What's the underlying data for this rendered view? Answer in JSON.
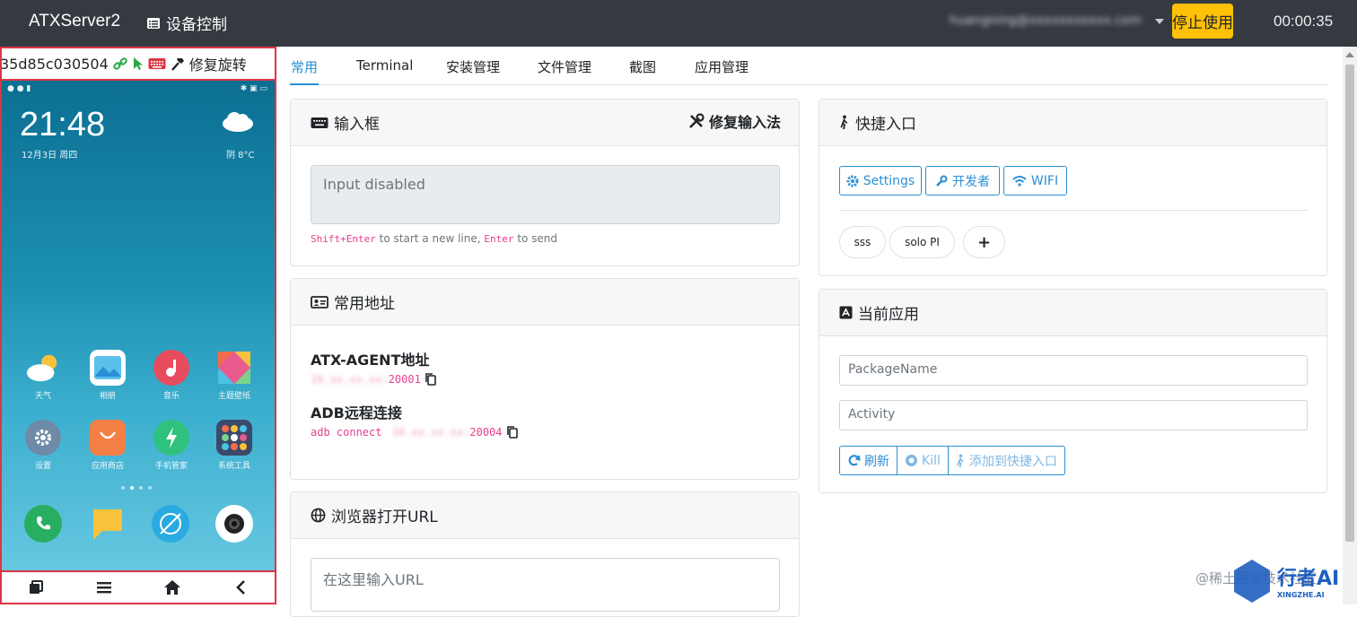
{
  "header": {
    "brand": "ATXServer2",
    "nav_device": "设备控制",
    "user_email": "huangning@xxxxxxxxxxx.com",
    "stop_label": "停止使用",
    "timer": "00:00:35"
  },
  "device": {
    "serial": "35d85c030504",
    "fix_rotate": "修复旋转",
    "screen": {
      "time": "21:48",
      "date": "12月3日 周四",
      "weather": "阴  8°C",
      "apps_row1": [
        "天气",
        "相册",
        "音乐",
        "主题壁纸"
      ],
      "apps_row2": [
        "设置",
        "应用商店",
        "手机管家",
        "系统工具"
      ]
    }
  },
  "tabs": [
    "常用",
    "Terminal",
    "安装管理",
    "文件管理",
    "截图",
    "应用管理"
  ],
  "input_card": {
    "title": "输入框",
    "fix_ime": "修复输入法",
    "placeholder": "Input disabled",
    "hint_key1": "Shift+Enter",
    "hint_text1": " to start a new line, ",
    "hint_key2": "Enter",
    "hint_text2": " to send"
  },
  "address_card": {
    "title": "常用地址",
    "atx_title": "ATX-AGENT地址",
    "atx_host": "10.xx.xx.xx:",
    "atx_port": "20001",
    "adb_title": "ADB远程连接",
    "adb_cmd": "adb connect ",
    "adb_host": "10.xx.xx.xx:",
    "adb_port": "20004"
  },
  "url_card": {
    "title": "浏览器打开URL",
    "placeholder": "在这里输入URL"
  },
  "shortcut_card": {
    "title": "快捷入口",
    "btn_settings": "Settings",
    "btn_dev": "开发者",
    "btn_wifi": "WIFI",
    "pills": [
      "sss",
      "solo PI",
      "+"
    ]
  },
  "current_app_card": {
    "title": "当前应用",
    "package_placeholder": "PackageName",
    "activity_placeholder": "Activity",
    "btn_refresh": "刷新",
    "btn_kill": "Kill",
    "btn_add": "添加到快捷入口"
  },
  "watermark": {
    "text": "@稀土掘金技术社区",
    "logo": "行者AI",
    "logo_sub": "XINGZHE.AI"
  },
  "colors": {
    "topbar": "#343a40",
    "accent": "#2a8fd4",
    "stop": "#ffc107",
    "danger": "#dc3545",
    "code": "#e83e8c"
  }
}
